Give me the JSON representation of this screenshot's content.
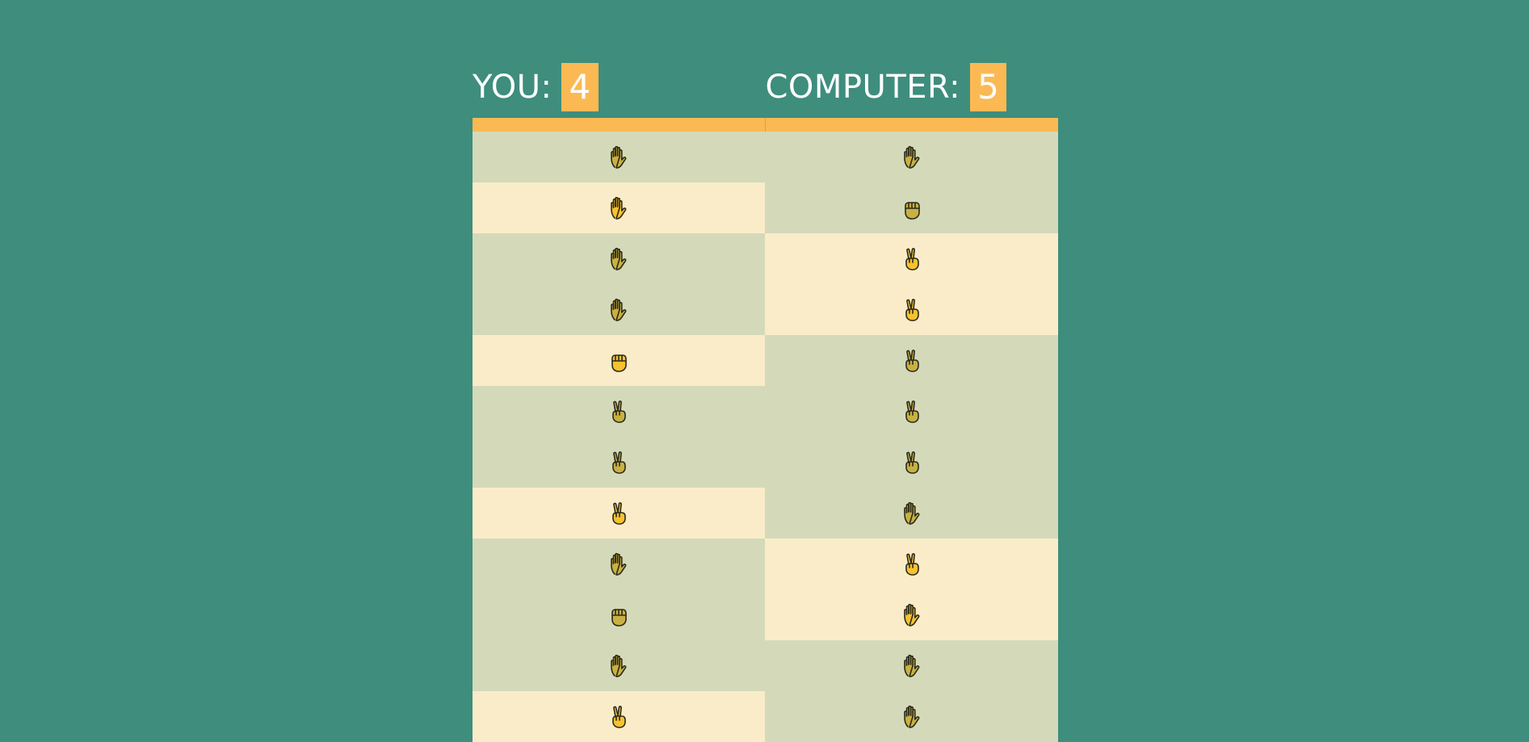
{
  "player": {
    "label": "YOU:",
    "score": "4"
  },
  "computer": {
    "label": "COMPUTER:",
    "score": "5"
  },
  "colors": {
    "background": "#3e8d7d",
    "accent": "#fbb953",
    "win_cell": "#faecc9",
    "lose_cell": "#d4dab9"
  },
  "rounds": [
    {
      "you": "paper-hand-icon",
      "you_result": "lose",
      "computer": "paper-hand-icon",
      "computer_result": "lose"
    },
    {
      "you": "paper-hand-icon",
      "you_result": "win",
      "computer": "rock-fist-icon",
      "computer_result": "lose"
    },
    {
      "you": "paper-hand-icon",
      "you_result": "lose",
      "computer": "scissors-hand-icon",
      "computer_result": "win"
    },
    {
      "you": "paper-hand-icon",
      "you_result": "lose",
      "computer": "scissors-hand-icon",
      "computer_result": "win"
    },
    {
      "you": "rock-fist-icon",
      "you_result": "win",
      "computer": "scissors-hand-icon",
      "computer_result": "lose"
    },
    {
      "you": "scissors-hand-icon",
      "you_result": "lose",
      "computer": "scissors-hand-icon",
      "computer_result": "lose"
    },
    {
      "you": "scissors-hand-icon",
      "you_result": "lose",
      "computer": "scissors-hand-icon",
      "computer_result": "lose"
    },
    {
      "you": "scissors-hand-icon",
      "you_result": "win",
      "computer": "paper-hand-icon",
      "computer_result": "lose"
    },
    {
      "you": "paper-hand-icon",
      "you_result": "lose",
      "computer": "scissors-hand-icon",
      "computer_result": "win"
    },
    {
      "you": "rock-fist-icon",
      "you_result": "lose",
      "computer": "paper-hand-icon",
      "computer_result": "win"
    },
    {
      "you": "paper-hand-icon",
      "you_result": "lose",
      "computer": "paper-hand-icon",
      "computer_result": "lose"
    },
    {
      "you": "scissors-hand-icon",
      "you_result": "win",
      "computer": "paper-hand-icon",
      "computer_result": "lose"
    }
  ]
}
